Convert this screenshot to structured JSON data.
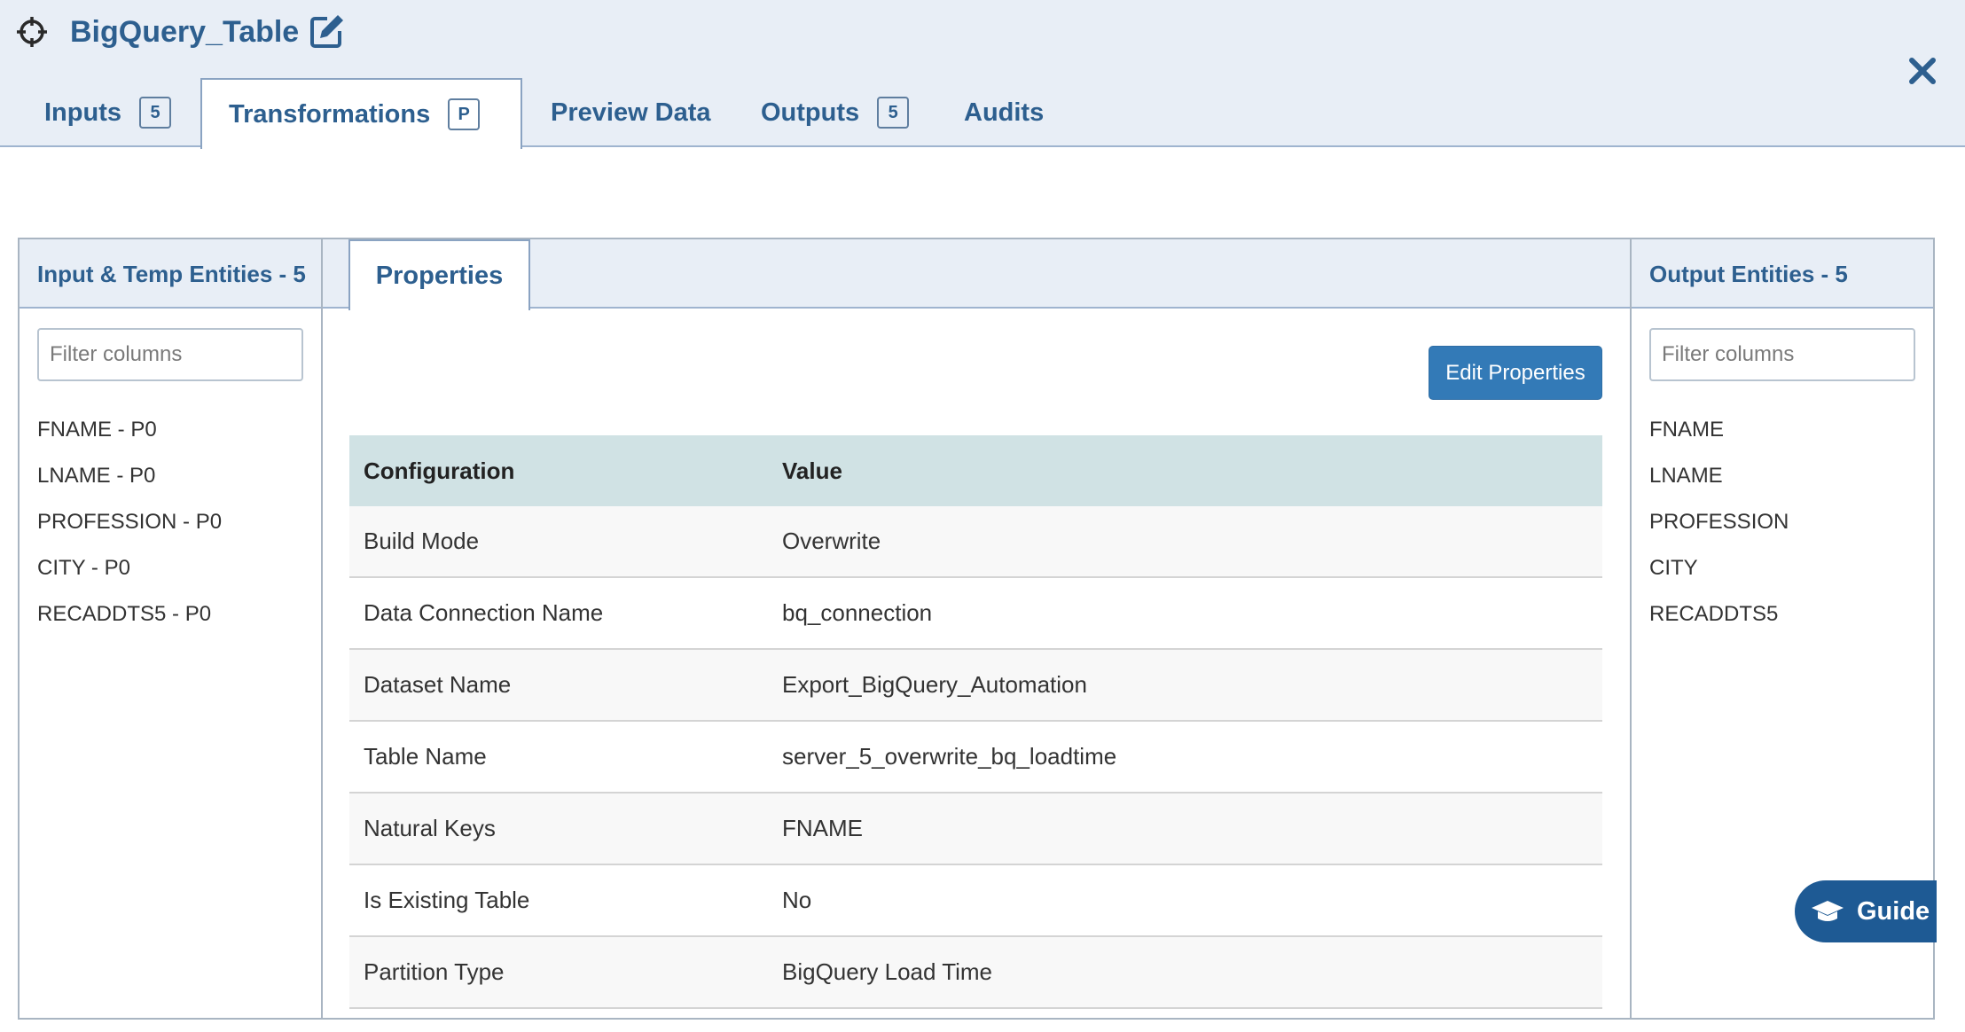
{
  "window": {
    "title": "BigQuery_Table"
  },
  "tabs": [
    {
      "label": "Inputs",
      "badge": "5"
    },
    {
      "label": "Transformations",
      "badge": "P"
    },
    {
      "label": "Preview Data",
      "badge": ""
    },
    {
      "label": "Outputs",
      "badge": "5"
    },
    {
      "label": "Audits",
      "badge": ""
    }
  ],
  "active_tab": "Transformations",
  "left_panel": {
    "title": "Input & Temp Entities - 5",
    "filter_placeholder": "Filter columns",
    "items": [
      "FNAME - P0",
      "LNAME - P0",
      "PROFESSION - P0",
      "CITY - P0",
      "RECADDTS5 - P0"
    ]
  },
  "center_panel": {
    "tab_label": "Properties",
    "edit_button": "Edit Properties",
    "table": {
      "headers": [
        "Configuration",
        "Value"
      ],
      "rows": [
        [
          "Build Mode",
          "Overwrite"
        ],
        [
          "Data Connection Name",
          "bq_connection"
        ],
        [
          "Dataset Name",
          "Export_BigQuery_Automation"
        ],
        [
          "Table Name",
          "server_5_overwrite_bq_loadtime"
        ],
        [
          "Natural Keys",
          "FNAME"
        ],
        [
          "Is Existing Table",
          "No"
        ],
        [
          "Partition Type",
          "BigQuery Load Time"
        ]
      ]
    }
  },
  "right_panel": {
    "title": "Output Entities  - 5",
    "filter_placeholder": "Filter columns",
    "items": [
      "FNAME",
      "LNAME",
      "PROFESSION",
      "CITY",
      "RECADDTS5"
    ]
  },
  "guide_button": "Guide",
  "colors": {
    "header_bg": "#e8eef6",
    "accent_text": "#2d5f8f",
    "primary_button": "#337ab7",
    "guide_button": "#1e5a94",
    "table_header_bg": "#d0e2e4"
  },
  "icons": [
    "crosshair-icon",
    "edit-icon",
    "close-icon",
    "graduation-cap-icon"
  ]
}
